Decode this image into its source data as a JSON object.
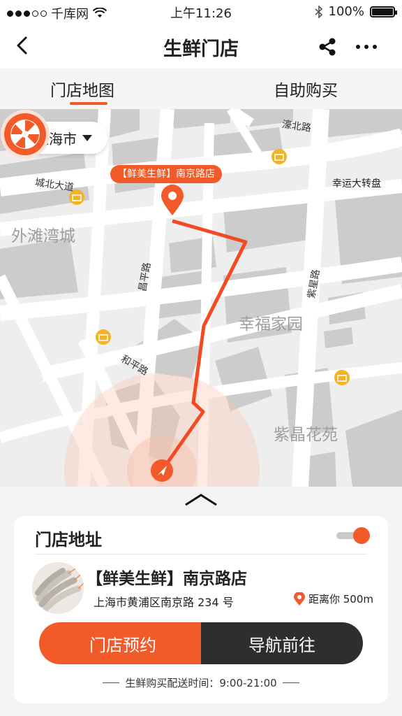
{
  "status_bar": {
    "carrier": "千库网",
    "time": "上午11:26",
    "battery": "100%"
  },
  "nav": {
    "title": "生鲜门店"
  },
  "tabs": [
    {
      "label": "门店地图",
      "active": true
    },
    {
      "label": "自助购买",
      "active": false
    }
  ],
  "map": {
    "city": "上海市",
    "streets": [
      "濠北路",
      "城北大道",
      "昌平路",
      "紫星路",
      "和平路"
    ],
    "districts": [
      "外滩湾城",
      "幸福家园",
      "紫晶花苑"
    ],
    "store_tag": "【鲜美生鲜】南京路店",
    "promo_label": "幸运大转盘"
  },
  "card": {
    "title": "门店地址",
    "toggle_on": true,
    "store_name": "【鲜美生鲜】南京路店",
    "address": "上海市黄浦区南京路 234 号",
    "distance": "距离你 500m",
    "reserve_label": "门店预约",
    "navigate_label": "导航前往",
    "hours": "生鲜购买配送时间：9:00-21:00"
  },
  "colors": {
    "accent": "#f25a2a",
    "dark": "#2e2e2e",
    "building": "#cccccc"
  }
}
